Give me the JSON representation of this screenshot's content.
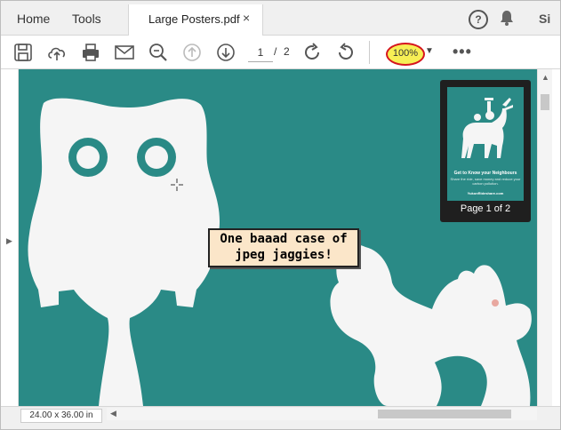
{
  "tabs": {
    "home": "Home",
    "tools": "Tools",
    "document": "Large Posters.pdf",
    "close_glyph": "×",
    "sign_in_partial": "Si"
  },
  "toolbar": {
    "icons": [
      "save-icon",
      "upload-cloud-icon",
      "print-icon",
      "email-icon",
      "zoom-search-icon",
      "previous-page-icon",
      "next-page-icon",
      "rotate-clockwise-icon",
      "rotate-counterclockwise-icon",
      "more-options-icon"
    ],
    "current_page": "1",
    "page_separator": "/",
    "total_pages": "2",
    "zoom": "100%",
    "more": "•••"
  },
  "thumbnail": {
    "caption": "Page 1 of 2",
    "headline": "Get to Know your Neighbours",
    "body": "Share the ride, save money and reduce your carbon pollution.",
    "url": "YukonRideshare.com"
  },
  "callout": {
    "line1": "One baaad case of",
    "line2": "jpeg jaggies!"
  },
  "status": {
    "page_size": "24.00 x 36.00 in"
  },
  "colors": {
    "poster_bg": "#2a8a86",
    "zoom_highlight": "#f7ef55",
    "zoom_ring": "#d6141e",
    "callout_bg": "#fbe6c9"
  }
}
